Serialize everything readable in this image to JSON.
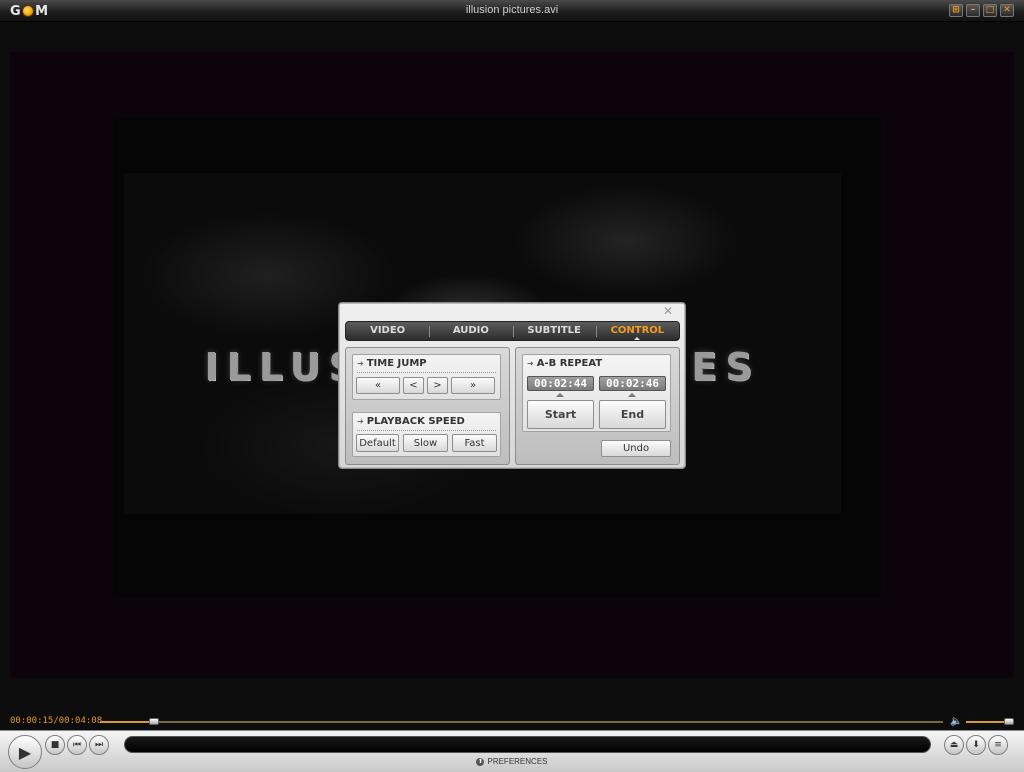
{
  "window": {
    "title": "illusion pictures.avi",
    "logo": {
      "left": "G",
      "right": "M"
    },
    "buttons": [
      {
        "name": "fullscreen-icon",
        "glyph": "⊞"
      },
      {
        "name": "minimize-icon",
        "glyph": "–"
      },
      {
        "name": "maximize-icon",
        "glyph": "□"
      },
      {
        "name": "close-icon",
        "glyph": "✕"
      }
    ]
  },
  "video": {
    "frame_text": "ILLUSION PICTURES"
  },
  "control_panel": {
    "close_glyph": "✕",
    "tabs": [
      {
        "label": "VIDEO",
        "active": false
      },
      {
        "label": "AUDIO",
        "active": false
      },
      {
        "label": "SUBTITLE",
        "active": false
      },
      {
        "label": "CONTROL",
        "active": true
      }
    ],
    "time_jump": {
      "title": "TIME JUMP",
      "buttons": [
        "«",
        "<",
        ">",
        "»"
      ]
    },
    "playback_speed": {
      "title": "PLAYBACK SPEED",
      "buttons": [
        "Default",
        "Slow",
        "Fast"
      ]
    },
    "ab_repeat": {
      "title": "A-B REPEAT",
      "start_time": "00:02:44",
      "end_time": "00:02:46",
      "start_label": "Start",
      "end_label": "End",
      "undo_label": "Undo"
    }
  },
  "player": {
    "timecode": "00:00:15/00:04:08",
    "seek_progress": 0.064,
    "volume_level": 0.95,
    "preferences_label": "PREFERENCES",
    "accent_color": "#e09a1a"
  }
}
